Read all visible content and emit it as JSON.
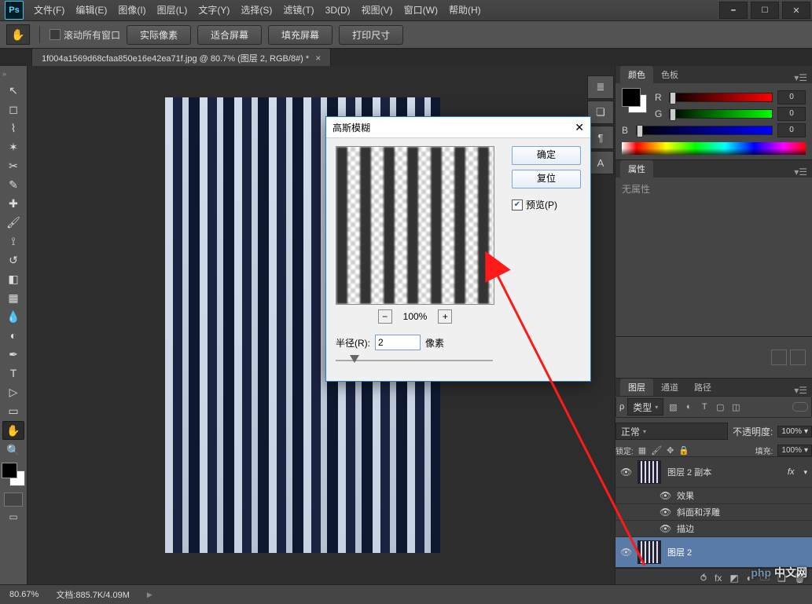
{
  "menu": {
    "items": [
      {
        "label": "文件(F)"
      },
      {
        "label": "编辑(E)"
      },
      {
        "label": "图像(I)"
      },
      {
        "label": "图层(L)"
      },
      {
        "label": "文字(Y)"
      },
      {
        "label": "选择(S)"
      },
      {
        "label": "滤镜(T)"
      },
      {
        "label": "3D(D)"
      },
      {
        "label": "视图(V)"
      },
      {
        "label": "窗口(W)"
      },
      {
        "label": "帮助(H)"
      }
    ]
  },
  "options": {
    "scroll_all_label": "滚动所有窗口",
    "buttons": [
      "实际像素",
      "适合屏幕",
      "填充屏幕",
      "打印尺寸"
    ]
  },
  "doc_tab": {
    "title": "1f004a1569d68cfaa850e16e42ea71f.jpg @ 80.7% (图层 2, RGB/8#) *"
  },
  "color_panel": {
    "tab_color": "颜色",
    "tab_swatch": "色板",
    "r": {
      "label": "R",
      "value": "0"
    },
    "g": {
      "label": "G",
      "value": "0"
    },
    "b": {
      "label": "B",
      "value": "0"
    }
  },
  "props_panel": {
    "tab": "属性",
    "empty_text": "无属性"
  },
  "layers_panel": {
    "tabs": {
      "layers": "图层",
      "channels": "通道",
      "paths": "路径"
    },
    "kind_label": "类型",
    "blend_mode": "正常",
    "opacity_label": "不透明度:",
    "opacity_value": "100%",
    "lock_label": "锁定:",
    "fill_label": "填充:",
    "fill_value": "100%",
    "fx_label": "效果",
    "fx_items": [
      "斜面和浮雕",
      "描边"
    ],
    "layers": [
      {
        "name": "图层 2 副本",
        "fx": true
      },
      {
        "name": "图层 2",
        "fx": false
      }
    ]
  },
  "dialog": {
    "title": "高斯模糊",
    "zoom": "100%",
    "radius_label": "半径(R):",
    "radius_value": "2",
    "radius_unit": "像素",
    "ok": "确定",
    "reset": "复位",
    "preview_label": "预览(P)"
  },
  "status": {
    "zoom": "80.67%",
    "doc_info": "文档:885.7K/4.09M"
  },
  "watermark": {
    "text": "中文网",
    "brand": "php"
  }
}
